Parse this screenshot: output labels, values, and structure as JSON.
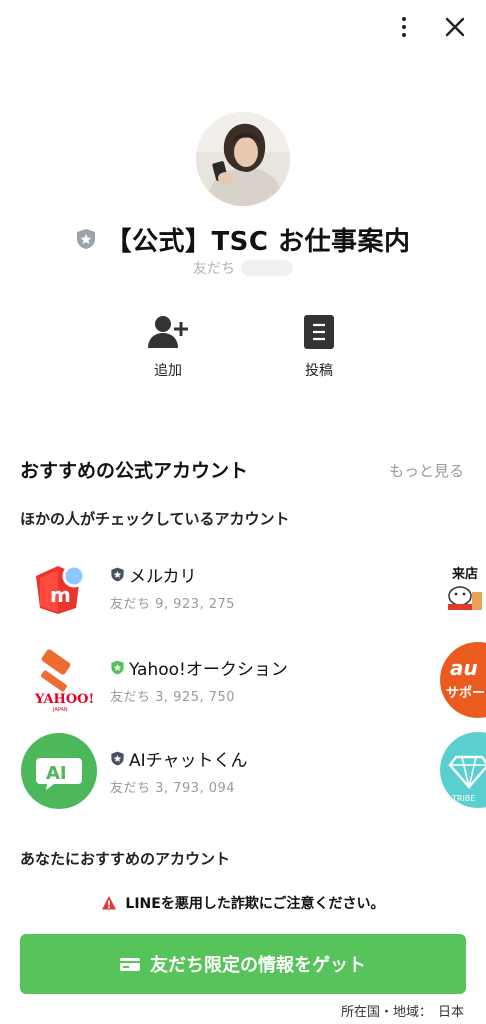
{
  "topbar": {
    "more_icon": "more-vertical-icon",
    "close_icon": "close-icon"
  },
  "profile": {
    "name": "【公式】TSC お仕事案内",
    "friends_label": "友だち",
    "badge_color": "#9da3ab"
  },
  "actions": [
    {
      "label": "追加",
      "icon": "add-friend-icon"
    },
    {
      "label": "投稿",
      "icon": "posts-icon"
    }
  ],
  "recommended": {
    "title": "おすすめの公式アカウント",
    "see_more": "もっと見る",
    "subtitle": "ほかの人がチェックしているアカウント",
    "items": [
      {
        "name": "メルカリ",
        "count": "友だち 9, 923, 275",
        "badge": "#4a5260"
      },
      {
        "name": "Yahoo!オークション",
        "count": "友だち 3, 925, 750",
        "badge": "#55c15a"
      },
      {
        "name": "AIチャットくん",
        "count": "友だち 3, 793, 094",
        "badge": "#4a5260"
      }
    ],
    "side_items": [
      {
        "text": "来店"
      },
      {
        "text": "au",
        "sub": "サポー"
      },
      {
        "text": "TRIBE"
      }
    ]
  },
  "section2": {
    "title": "あなたにおすすめのアカウント"
  },
  "warning": {
    "text": "LINEを悪用した詐欺にご注意ください。"
  },
  "cta": {
    "label": "友だち限定の情報をゲット",
    "color": "#56c45b"
  },
  "region": {
    "label": "所在国・地域：",
    "value": "日本"
  }
}
